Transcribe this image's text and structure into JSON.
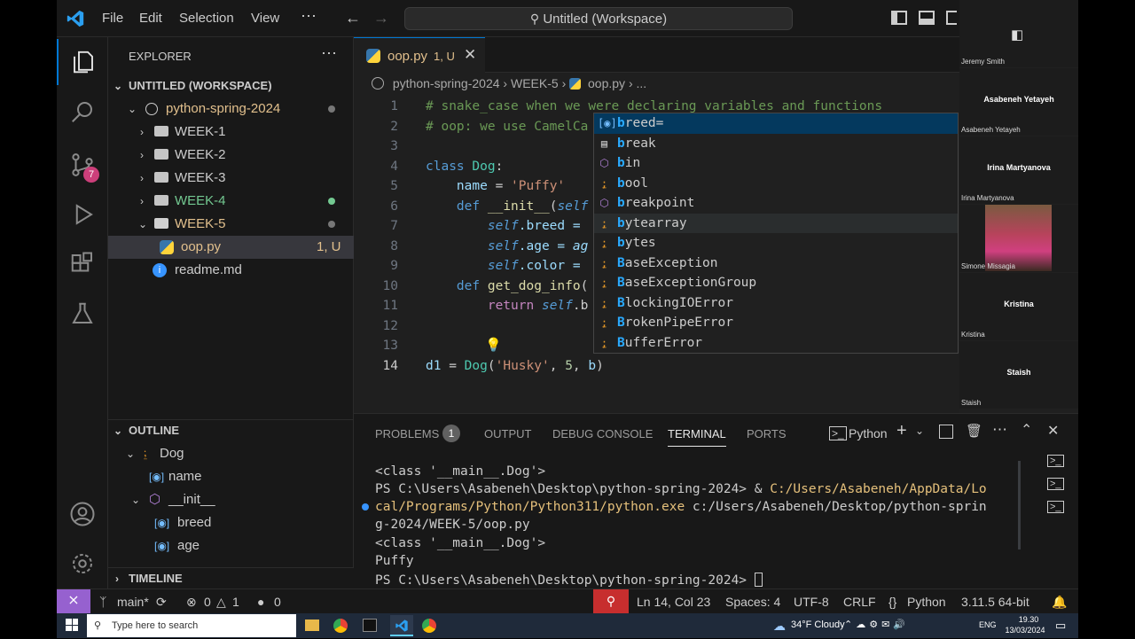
{
  "titlebar": {
    "menus": [
      "File",
      "Edit",
      "Selection",
      "View",
      "⋯"
    ],
    "command_center": "Untitled (Workspace)"
  },
  "activity": {
    "scm_badge": "7"
  },
  "explorer": {
    "title": "EXPLORER",
    "workspace": "UNTITLED (WORKSPACE)",
    "root_folder": "python-spring-2024",
    "items": [
      {
        "label": "WEEK-1"
      },
      {
        "label": "WEEK-2"
      },
      {
        "label": "WEEK-3"
      },
      {
        "label": "WEEK-4"
      },
      {
        "label": "WEEK-5"
      },
      {
        "label": "oop.py",
        "badge": "1, U"
      },
      {
        "label": "readme.md"
      }
    ]
  },
  "outline": {
    "title": "OUTLINE",
    "items": [
      "Dog",
      "name",
      "__init__",
      "breed",
      "age"
    ]
  },
  "timeline": {
    "title": "TIMELINE"
  },
  "tab": {
    "label": "oop.py",
    "badge": "1, U"
  },
  "breadcrumb": [
    "python-spring-2024",
    "WEEK-5",
    "oop.py",
    "..."
  ],
  "code": {
    "line_numbers": [
      "1",
      "2",
      "3",
      "4",
      "5",
      "6",
      "7",
      "8",
      "9",
      "10",
      "11",
      "12",
      "13",
      "14"
    ],
    "l1": "# snake_case when we were declaring variables and functions",
    "l2": "# oop: we use CamelCa",
    "l4a": "class",
    "l4b": "Dog",
    "l5a": "name",
    "l5b": "'Puffy'",
    "l6a": "def",
    "l6b": "__init__",
    "l6c": "self",
    "l7a": "self",
    "l7b": ".breed =",
    "l8a": "self",
    "l8b": ".age = ",
    "l8c": "ag",
    "l9a": "self",
    "l9b": ".color =",
    "l10a": "def",
    "l10b": "get_dog_info",
    "l11a": "return",
    "l11b": "self",
    "l11c": ".b",
    "l14a": "d1",
    "l14b": "Dog",
    "l14c": "'Husky'",
    "l14d": "5",
    "l14e": "b"
  },
  "suggestions": [
    {
      "first": "b",
      "rest": "reed=",
      "icon": "variable-icon"
    },
    {
      "first": "b",
      "rest": "reak",
      "icon": "keyword-icon"
    },
    {
      "first": "b",
      "rest": "in",
      "icon": "method-icon"
    },
    {
      "first": "b",
      "rest": "ool",
      "icon": "class-icon"
    },
    {
      "first": "b",
      "rest": "reakpoint",
      "icon": "method-icon"
    },
    {
      "first": "b",
      "rest": "ytearray",
      "icon": "class-icon"
    },
    {
      "first": "b",
      "rest": "ytes",
      "icon": "class-icon"
    },
    {
      "first": "B",
      "rest": "aseException",
      "icon": "class-icon"
    },
    {
      "first": "B",
      "rest": "aseExceptionGroup",
      "icon": "class-icon"
    },
    {
      "first": "B",
      "rest": "lockingIOError",
      "icon": "class-icon"
    },
    {
      "first": "B",
      "rest": "rokenPipeError",
      "icon": "class-icon"
    },
    {
      "first": "B",
      "rest": "ufferError",
      "icon": "class-icon"
    }
  ],
  "panel": {
    "tabs": [
      "PROBLEMS",
      "OUTPUT",
      "DEBUG CONSOLE",
      "TERMINAL",
      "PORTS"
    ],
    "problems_count": "1",
    "shell": "Python",
    "terminal_lines": [
      "<class '__main__.Dog'>",
      "PS C:\\Users\\Asabeneh\\Desktop\\python-spring-2024> & ",
      "C:/Users/Asabeneh/AppData/Lo",
      "cal/Programs/Python/Python311/python.exe",
      " c:/Users/Asabeneh/Desktop/python-sprin",
      "g-2024/WEEK-5/oop.py",
      "<class '__main__.Dog'>",
      "Puffy",
      "PS C:\\Users\\Asabeneh\\Desktop\\python-spring-2024> "
    ]
  },
  "status": {
    "branch": "main*",
    "errors": "0",
    "warnings": "1",
    "ports": "0",
    "cursor": "Ln 14, Col 23",
    "spaces": "Spaces: 4",
    "encoding": "UTF-8",
    "eol": "CRLF",
    "language": "Python",
    "interpreter": "3.11.5 64-bit"
  },
  "participants": [
    {
      "name": "Jeremy Smith",
      "center": ""
    },
    {
      "name": "Asabeneh Yetayeh",
      "center": "Asabeneh Yetayeh"
    },
    {
      "name": "Irina Martyanova",
      "center": "Irina Martyanova"
    },
    {
      "name": "Simone Missagia",
      "center": ""
    },
    {
      "name": "Kristina",
      "center": "Kristina"
    },
    {
      "name": "Staish",
      "center": "Staish"
    }
  ],
  "taskbar": {
    "search_placeholder": "Type here to search",
    "weather": "34°F  Cloudy",
    "lang": "ENG",
    "time": "19.30",
    "date": "13/03/2024"
  }
}
